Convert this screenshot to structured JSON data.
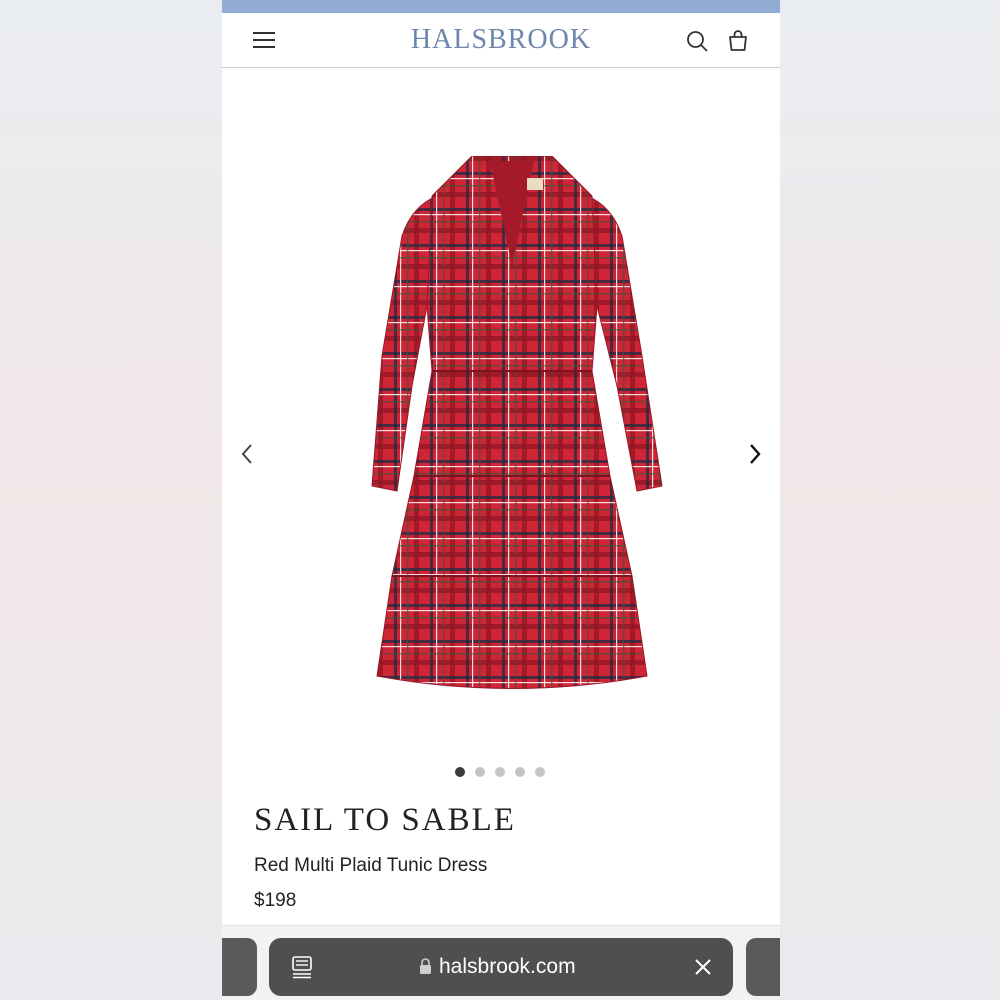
{
  "header": {
    "logo_text": "HALSBROOK",
    "logo_color": "#6e86ad",
    "top_strip_color": "#93acd3"
  },
  "gallery": {
    "image": "red-plaid-tunic-dress",
    "dots_count": 5,
    "active_dot": 1
  },
  "product": {
    "brand": "SAIL TO SABLE",
    "name": "Red Multi Plaid Tunic Dress",
    "price": "$198"
  },
  "browser": {
    "url": "halsbrook.com"
  }
}
